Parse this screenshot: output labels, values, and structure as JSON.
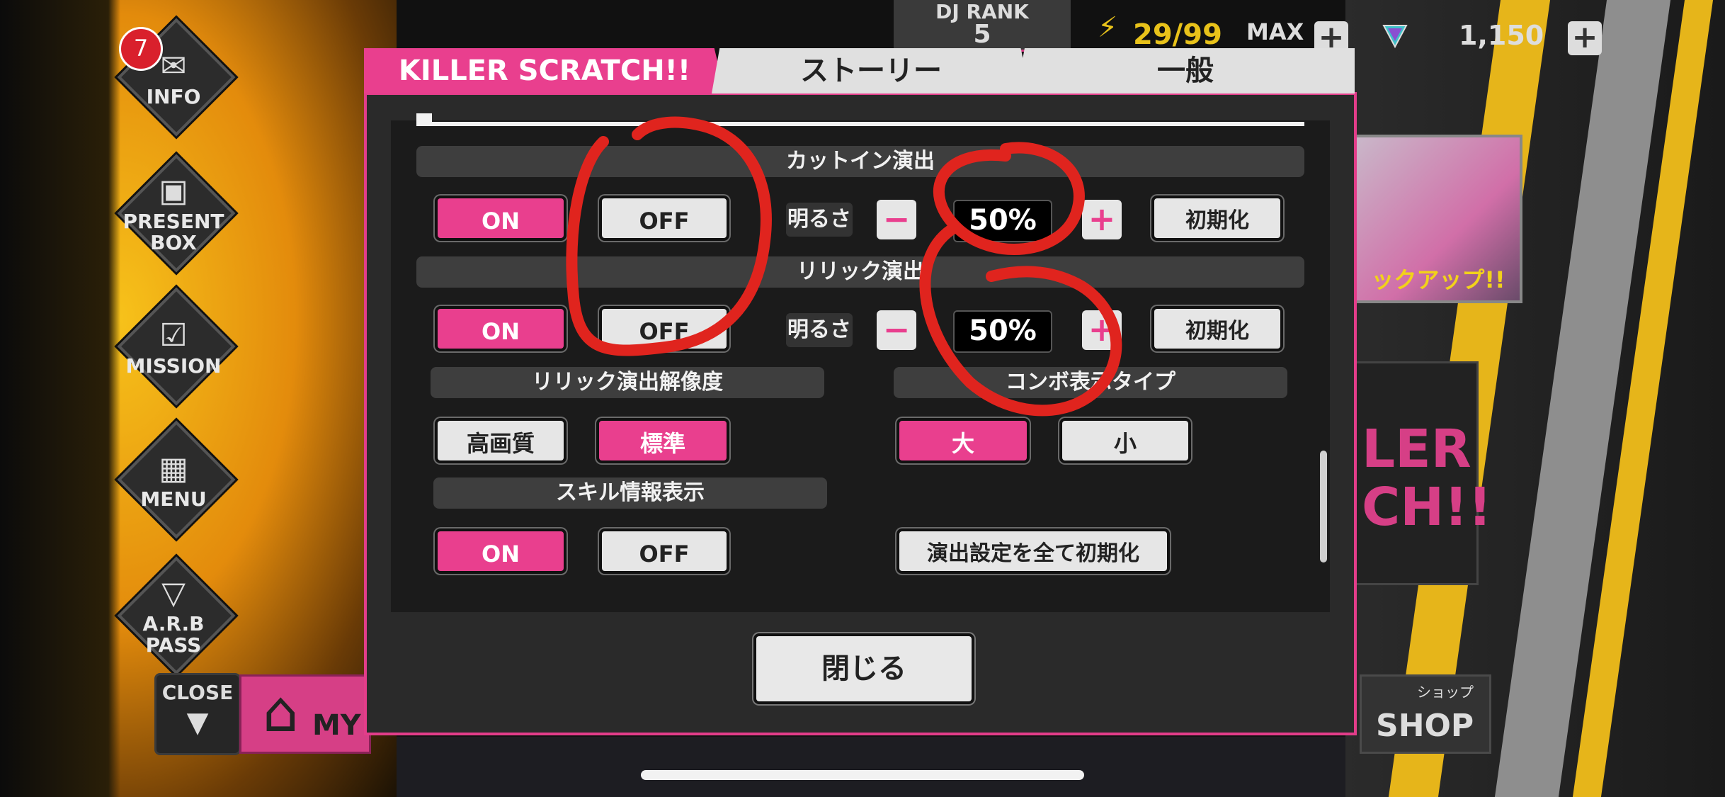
{
  "sidebar": {
    "info": {
      "label": "INFO",
      "badge": "7"
    },
    "present": {
      "label1": "PRESENT",
      "label2": "BOX"
    },
    "mission": {
      "label": "MISSION"
    },
    "menu": {
      "label": "MENU"
    },
    "pass": {
      "label1": "A.R.B",
      "label2": "PASS"
    },
    "close": {
      "label": "CLOSE",
      "arrow": "▼"
    },
    "my": {
      "label": "MY"
    }
  },
  "status": {
    "dj_rank_label": "DJ RANK",
    "dj_rank_value": "5",
    "energy": "29/99",
    "max_label": "MAX",
    "gems": "1,150"
  },
  "right": {
    "banner_text": "ックアップ!!",
    "promo_line1": "LER",
    "promo_line2": "CH!!",
    "shop_small": "ショップ",
    "shop_label": "SHOP"
  },
  "tabs": {
    "killer": "KILLER SCRATCH!!",
    "story": "ストーリー",
    "general": "一般"
  },
  "settings": {
    "cutin": {
      "title": "カットイン演出",
      "on": "ON",
      "off": "OFF",
      "brightness_label": "明るさ",
      "value": "50%",
      "reset": "初期化"
    },
    "lyric": {
      "title": "リリック演出",
      "on": "ON",
      "off": "OFF",
      "brightness_label": "明るさ",
      "value": "50%",
      "reset": "初期化"
    },
    "lyric_resolution": {
      "title": "リリック演出解像度",
      "high": "高画質",
      "standard": "標準"
    },
    "combo_type": {
      "title": "コンボ表示タイプ",
      "large": "大",
      "small": "小"
    },
    "skill_info": {
      "title": "スキル情報表示",
      "on": "ON",
      "off": "OFF"
    },
    "reset_all": "演出設定を全て初期化"
  },
  "dialog": {
    "close": "閉じる"
  },
  "annotation": {
    "color": "#e0241e"
  },
  "colors": {
    "accent": "#e93f8e"
  }
}
